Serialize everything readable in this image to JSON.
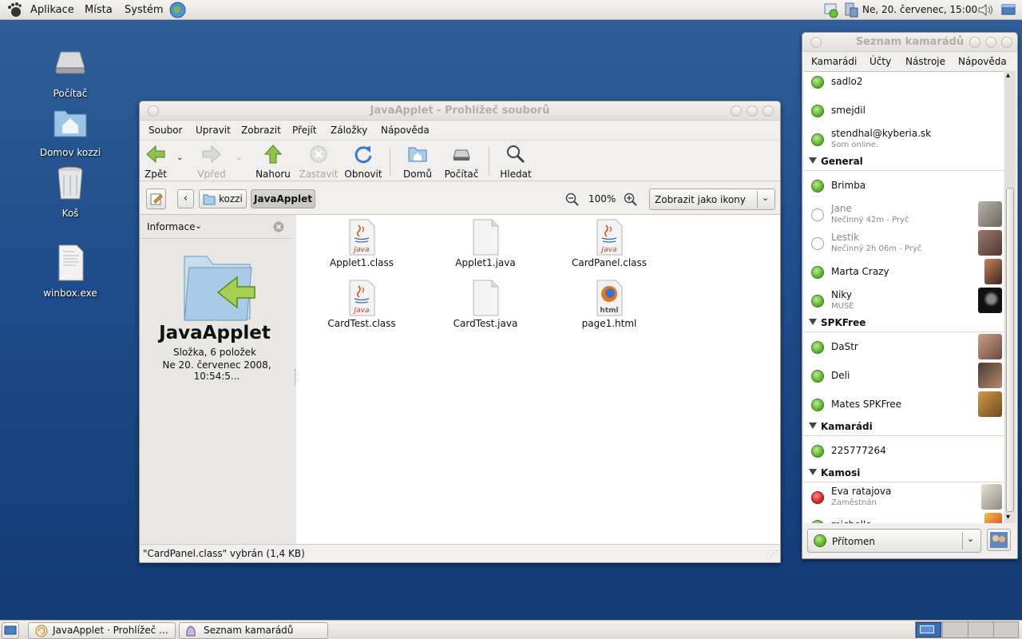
{
  "top_panel": {
    "menus": [
      "Aplikace",
      "Místa",
      "Systém"
    ],
    "clock": "Ne, 20. červenec, 15:00"
  },
  "desktop": {
    "icons": [
      {
        "label": "Počítač"
      },
      {
        "label": "Domov kozzi"
      },
      {
        "label": "Koš"
      },
      {
        "label": "winbox.exe"
      }
    ]
  },
  "file_manager": {
    "title": "JavaApplet - Prohlížeč souborů",
    "menu": [
      "Soubor",
      "Upravit",
      "Zobrazit",
      "Přejít",
      "Záložky",
      "Nápověda"
    ],
    "toolbar": {
      "back": "Zpět",
      "forward": "Vpřed",
      "up": "Nahoru",
      "stop": "Zastavit",
      "reload": "Obnovit",
      "home": "Domů",
      "computer": "Počítač",
      "search": "Hledat"
    },
    "location": {
      "crumbs": [
        "kozzi",
        "JavaApplet"
      ],
      "zoom": "100%",
      "view_mode": "Zobrazit jako ikony"
    },
    "sidebar": {
      "header": "Informace",
      "folder_name": "JavaApplet",
      "info_line1": "Složka, 6 položek",
      "info_line2": "Ne 20. červenec 2008, 10:54:5..."
    },
    "files": [
      {
        "name": "Applet1.class",
        "type": "java"
      },
      {
        "name": "Applet1.java",
        "type": "blank"
      },
      {
        "name": "CardPanel.class",
        "type": "java"
      },
      {
        "name": "CardTest.class",
        "type": "java"
      },
      {
        "name": "CardTest.java",
        "type": "blank"
      },
      {
        "name": "page1.html",
        "type": "html"
      }
    ],
    "statusbar": "\"CardPanel.class\" vybrán (1,4 KB)"
  },
  "buddy_list": {
    "title": "Seznam kamarádů",
    "menu": [
      "Kamarádi",
      "Účty",
      "Nástroje",
      "Nápověda"
    ],
    "top_buddies": [
      {
        "name": "sadlo2"
      },
      {
        "name": "smejdil"
      },
      {
        "name": "stendhal@kyberia.sk",
        "status": "Som online."
      }
    ],
    "groups": [
      {
        "name": "General",
        "buddies": [
          {
            "name": "Brimba"
          },
          {
            "name": "Jane",
            "status": "Nečinný 42m - Pryč"
          },
          {
            "name": "Lestik",
            "status": "Nečinný 2h 06m - Pryč"
          },
          {
            "name": "Marta Crazy"
          },
          {
            "name": "Niky",
            "status": "MUSE"
          }
        ]
      },
      {
        "name": "SPKFree",
        "buddies": [
          {
            "name": "DaStr"
          },
          {
            "name": "Deli"
          },
          {
            "name": "Mates SPKFree"
          }
        ]
      },
      {
        "name": "Kamarádi",
        "buddies": [
          {
            "name": "225777264"
          }
        ]
      },
      {
        "name": "Kamosi",
        "buddies": [
          {
            "name": "Eva ratajova",
            "status": "Zaměstnán"
          },
          {
            "name": "michelle"
          }
        ]
      }
    ],
    "status_select": "Přítomen"
  },
  "taskbar": {
    "tasks": [
      "JavaApplet · Prohlížeč ...",
      "Seznam kamarádů"
    ]
  }
}
